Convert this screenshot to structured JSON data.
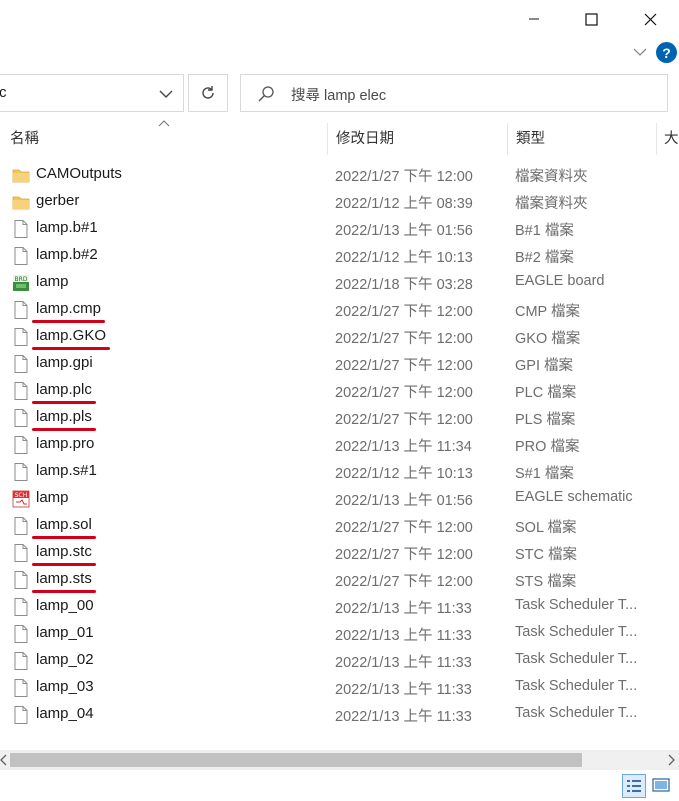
{
  "address": {
    "path_fragment": "c"
  },
  "search": {
    "placeholder": "搜尋 lamp elec"
  },
  "columns": {
    "name": "名稱",
    "date": "修改日期",
    "type": "類型",
    "size": "大"
  },
  "files": [
    {
      "name": "CAMOutputs",
      "date": "2022/1/27 下午 12:00",
      "type": "檔案資料夾",
      "icon": "folder-icon",
      "underlined": false
    },
    {
      "name": "gerber",
      "date": "2022/1/12 上午 08:39",
      "type": "檔案資料夾",
      "icon": "folder-icon",
      "underlined": false
    },
    {
      "name": "lamp.b#1",
      "date": "2022/1/13 上午 01:56",
      "type": "B#1 檔案",
      "icon": "file-icon",
      "underlined": false
    },
    {
      "name": "lamp.b#2",
      "date": "2022/1/12 上午 10:13",
      "type": "B#2 檔案",
      "icon": "file-icon",
      "underlined": false
    },
    {
      "name": "lamp",
      "date": "2022/1/18 下午 03:28",
      "type": "EAGLE board",
      "icon": "eagle-board-icon",
      "underlined": false
    },
    {
      "name": "lamp.cmp",
      "date": "2022/1/27 下午 12:00",
      "type": "CMP 檔案",
      "icon": "file-icon",
      "underlined": true
    },
    {
      "name": "lamp.GKO",
      "date": "2022/1/27 下午 12:00",
      "type": "GKO 檔案",
      "icon": "file-icon",
      "underlined": true
    },
    {
      "name": "lamp.gpi",
      "date": "2022/1/27 下午 12:00",
      "type": "GPI 檔案",
      "icon": "file-icon",
      "underlined": false
    },
    {
      "name": "lamp.plc",
      "date": "2022/1/27 下午 12:00",
      "type": "PLC 檔案",
      "icon": "file-icon",
      "underlined": true
    },
    {
      "name": "lamp.pls",
      "date": "2022/1/27 下午 12:00",
      "type": "PLS 檔案",
      "icon": "file-icon",
      "underlined": true
    },
    {
      "name": "lamp.pro",
      "date": "2022/1/13 上午 11:34",
      "type": "PRO 檔案",
      "icon": "file-icon",
      "underlined": false
    },
    {
      "name": "lamp.s#1",
      "date": "2022/1/12 上午 10:13",
      "type": "S#1 檔案",
      "icon": "file-icon",
      "underlined": false
    },
    {
      "name": "lamp",
      "date": "2022/1/13 上午 01:56",
      "type": "EAGLE schematic",
      "icon": "eagle-schematic-icon",
      "underlined": false
    },
    {
      "name": "lamp.sol",
      "date": "2022/1/27 下午 12:00",
      "type": "SOL 檔案",
      "icon": "file-icon",
      "underlined": true
    },
    {
      "name": "lamp.stc",
      "date": "2022/1/27 下午 12:00",
      "type": "STC 檔案",
      "icon": "file-icon",
      "underlined": true
    },
    {
      "name": "lamp.sts",
      "date": "2022/1/27 下午 12:00",
      "type": "STS 檔案",
      "icon": "file-icon",
      "underlined": true
    },
    {
      "name": "lamp_00",
      "date": "2022/1/13 上午 11:33",
      "type": "Task Scheduler T...",
      "icon": "file-icon",
      "underlined": false
    },
    {
      "name": "lamp_01",
      "date": "2022/1/13 上午 11:33",
      "type": "Task Scheduler T...",
      "icon": "file-icon",
      "underlined": false
    },
    {
      "name": "lamp_02",
      "date": "2022/1/13 上午 11:33",
      "type": "Task Scheduler T...",
      "icon": "file-icon",
      "underlined": false
    },
    {
      "name": "lamp_03",
      "date": "2022/1/13 上午 11:33",
      "type": "Task Scheduler T...",
      "icon": "file-icon",
      "underlined": false
    },
    {
      "name": "lamp_04",
      "date": "2022/1/13 上午 11:33",
      "type": "Task Scheduler T...",
      "icon": "file-icon",
      "underlined": false
    }
  ],
  "badges": {
    "brd": "BRD",
    "sch": "SCH"
  },
  "colors": {
    "accent": "#0063b1",
    "annotation": "#d0021b",
    "folder": "#f2c55c"
  }
}
